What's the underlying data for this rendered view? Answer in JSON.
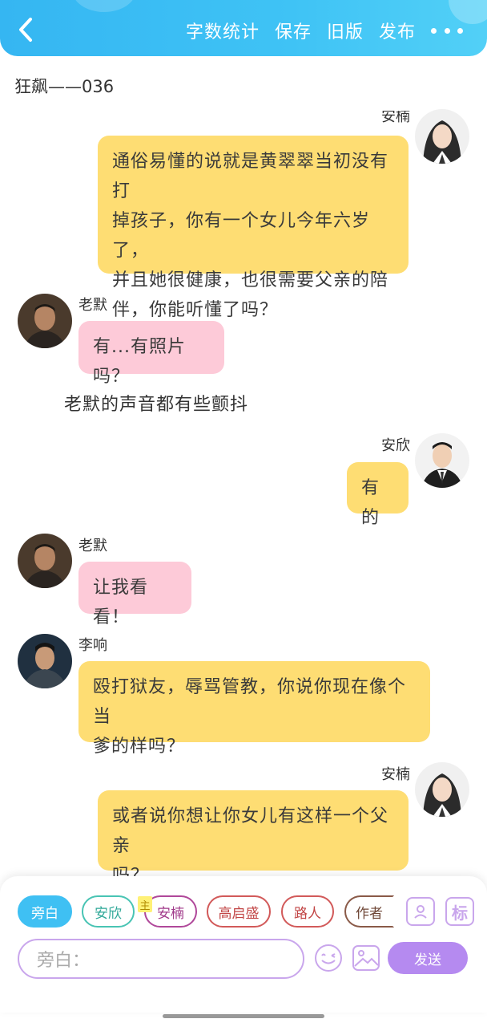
{
  "header": {
    "actions": [
      "字数统计",
      "保存",
      "旧版",
      "发布"
    ],
    "colors": {
      "start": "#35b6f2",
      "end": "#52d0f7"
    }
  },
  "chapter_title": "狂飙——036",
  "messages": [
    {
      "speaker": "安楠",
      "side": "right",
      "color": "yellow",
      "lines": [
        "通俗易懂的说就是黄翠翠当初没有打",
        "掉孩子，你有一个女儿今年六岁了，",
        "并且她很健康，也很需要父亲的陪",
        "伴，你能听懂了吗？"
      ]
    },
    {
      "speaker": "老默",
      "side": "left",
      "color": "pink",
      "lines": [
        "有...有照片吗？"
      ]
    },
    {
      "speaker": "安欣",
      "side": "right",
      "color": "yellow",
      "lines": [
        "有的"
      ]
    },
    {
      "speaker": "老默",
      "side": "left",
      "color": "pink",
      "lines": [
        "让我看看！"
      ]
    },
    {
      "speaker": "李响",
      "side": "left",
      "color": "yellow",
      "lines": [
        "殴打狱友，辱骂管教，你说你现在像个当",
        "爹的样吗？"
      ]
    },
    {
      "speaker": "安楠",
      "side": "right",
      "color": "yellow",
      "lines": [
        "或者说你想让你女儿有这样一个父亲",
        "吗？"
      ]
    }
  ],
  "narration": "老默的声音都有些颤抖",
  "role_chips": [
    {
      "label": "旁白",
      "selected": true,
      "color": "#3fc0f3"
    },
    {
      "label": "安欣",
      "color": "#49c4b4"
    },
    {
      "label": "安楠",
      "color": "#b0489a",
      "badge": "主"
    },
    {
      "label": "高启盛",
      "color": "#d25a5a"
    },
    {
      "label": "路人",
      "color": "#d25a5a"
    },
    {
      "label": "作者",
      "color": "#8a5a48"
    }
  ],
  "icons": {
    "add_role": "person-card-icon",
    "mark": "标"
  },
  "input": {
    "placeholder": "旁白："
  },
  "send_label": "发送",
  "accent": "#b58af0"
}
